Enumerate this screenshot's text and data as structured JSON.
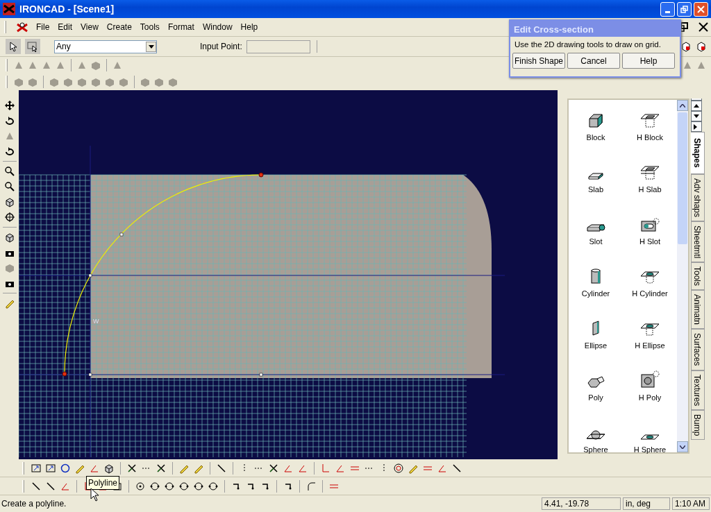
{
  "window": {
    "title": "IRONCAD - [Scene1]"
  },
  "menu": [
    {
      "label": "File"
    },
    {
      "label": "Edit"
    },
    {
      "label": "View"
    },
    {
      "label": "Create"
    },
    {
      "label": "Tools"
    },
    {
      "label": "Format"
    },
    {
      "label": "Window"
    },
    {
      "label": "Help"
    }
  ],
  "select_toolbar": {
    "filter": "Any",
    "input_point_label": "Input Point:"
  },
  "dialog": {
    "title": "Edit Cross-section",
    "message": "Use the 2D drawing tools to draw on grid.",
    "buttons": [
      "Finish Shape",
      "Cancel",
      "Help"
    ]
  },
  "viewport": {
    "axis_label": "W"
  },
  "shapes": [
    {
      "label": "Block",
      "kind": "block"
    },
    {
      "label": "H Block",
      "kind": "hblock"
    },
    {
      "label": "Slab",
      "kind": "slab"
    },
    {
      "label": "H Slab",
      "kind": "hslab"
    },
    {
      "label": "Slot",
      "kind": "slot"
    },
    {
      "label": "H Slot",
      "kind": "hslot"
    },
    {
      "label": "Cylinder",
      "kind": "cylinder"
    },
    {
      "label": "H Cylinder",
      "kind": "hcylinder"
    },
    {
      "label": "Ellipse",
      "kind": "ellipse"
    },
    {
      "label": "H Ellipse",
      "kind": "hellipse"
    },
    {
      "label": "Poly",
      "kind": "poly"
    },
    {
      "label": "H Poly",
      "kind": "hpoly"
    },
    {
      "label": "Sphere",
      "kind": "sphere"
    },
    {
      "label": "H Sphere",
      "kind": "hsphere"
    }
  ],
  "side_tabs": [
    {
      "label": "Shapes",
      "selected": true
    },
    {
      "label": "Adv shaps",
      "selected": false
    },
    {
      "label": "Sheetmtl",
      "selected": false
    },
    {
      "label": "Tools",
      "selected": false
    },
    {
      "label": "Animatn",
      "selected": false
    },
    {
      "label": "Surfaces",
      "selected": false
    },
    {
      "label": "Textures",
      "selected": false
    },
    {
      "label": "Bump",
      "selected": false
    }
  ],
  "tooltip": "Polyline",
  "status_bar": {
    "message": "Create a polyline.",
    "coordinates": "4.41, -19.78",
    "units": "in, deg",
    "time": "1:10 AM"
  }
}
